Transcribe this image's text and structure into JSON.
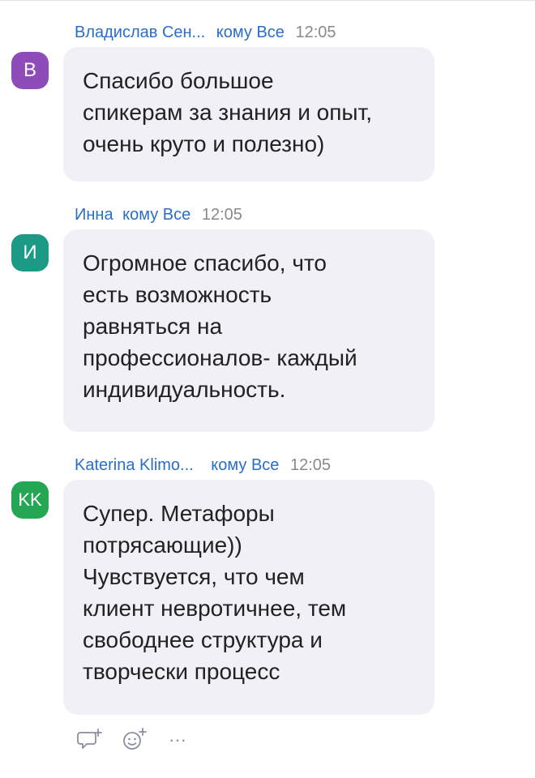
{
  "messages": [
    {
      "sender": "Владислав Сен...",
      "to_word": "кому",
      "recipient": "Все",
      "time": "12:05",
      "avatar_letter": "В",
      "avatar_color": "#8e4cb8",
      "text": "Спасибо большое\nспикерам за знания и опыт,\nочень круто и полезно)"
    },
    {
      "sender": "Инна",
      "to_word": "кому",
      "recipient": "Все",
      "time": "12:05",
      "avatar_letter": "И",
      "avatar_color": "#1b9a86",
      "text": "Огромное спасибо, что\nесть возможность\nравняться на\nпрофессионалов- каждый\nиндивидуальность."
    },
    {
      "sender": "Katerina Klimo...",
      "to_word": "кому",
      "recipient": "Все",
      "time": "12:05",
      "avatar_letter": "KK",
      "avatar_color": "#24a652",
      "text": "Супер. Метафоры\nпотрясающие))\nЧувствуется, что чем\nклиент невротичнее, тем\nсвободнее структура и\nтворчески процесс"
    }
  ],
  "actions": {
    "reply_icon": "reply-plus-icon",
    "emoji_icon": "emoji-add-icon",
    "more_label": "···"
  }
}
